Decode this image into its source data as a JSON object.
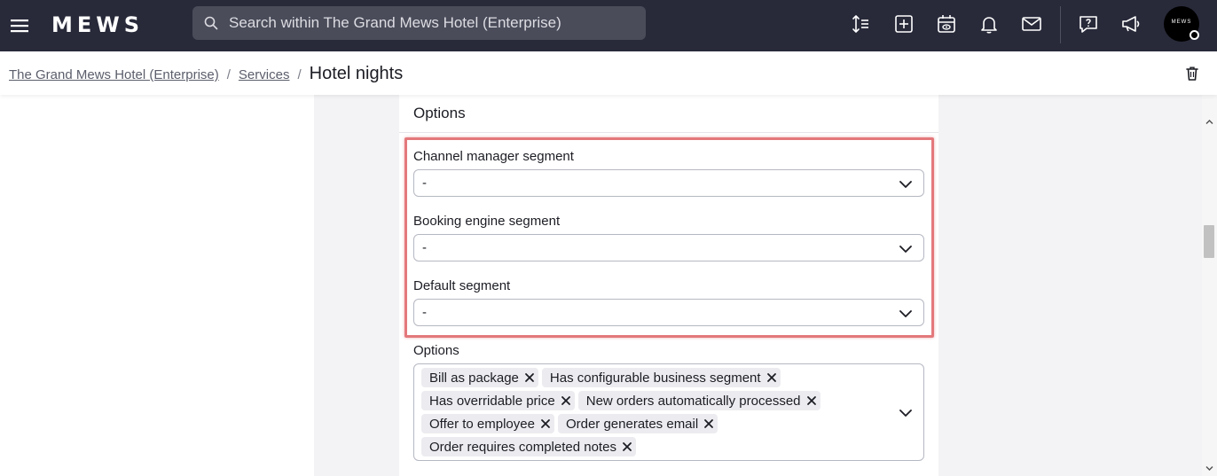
{
  "topbar": {
    "menu_icon": "hamburger-menu-icon",
    "logo_text": "MEWS",
    "search": {
      "placeholder": "Search within The Grand Mews Hotel (Enterprise)",
      "value": "",
      "icon": "search-icon"
    },
    "icons": [
      "sort-lines-icon",
      "plus-square-icon",
      "calendar-view-icon",
      "bell-icon",
      "mail-icon",
      "help-chat-icon",
      "megaphone-icon"
    ],
    "avatar_text": "MEWS"
  },
  "breadcrumb": {
    "items": [
      "The Grand Mews Hotel (Enterprise)",
      "Services"
    ],
    "separator": "/",
    "current": "Hotel nights"
  },
  "card": {
    "title": "Options",
    "fields": [
      {
        "label": "Channel manager segment",
        "value": "-"
      },
      {
        "label": "Booking engine segment",
        "value": "-"
      },
      {
        "label": "Default segment",
        "value": "-"
      }
    ],
    "options": {
      "label": "Options",
      "chips": [
        "Bill as package",
        "Has configurable business segment",
        "Has overridable price",
        "New orders automatically processed",
        "Offer to employee",
        "Order generates email",
        "Order requires completed notes"
      ]
    }
  },
  "colors": {
    "topbar": "#282a3a",
    "search_bg": "#4a4c5a",
    "highlight": "#e3787b",
    "content_bg": "#f3f3f5",
    "chip_bg": "#ececf0"
  }
}
